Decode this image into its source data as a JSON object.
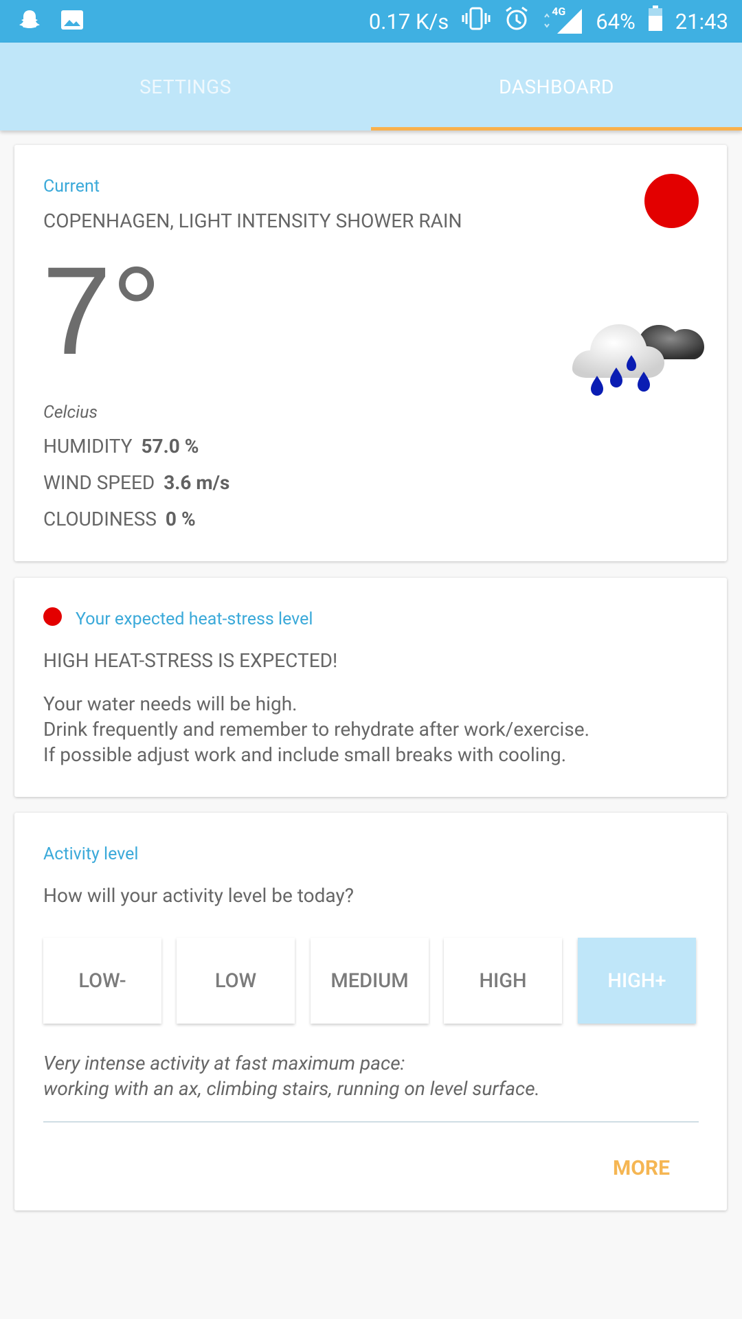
{
  "status_bar": {
    "network_speed": "0.17 K/s",
    "network_type": "4G",
    "battery": "64%",
    "time": "21:43"
  },
  "tabs": {
    "settings": "SETTINGS",
    "dashboard": "DASHBOARD",
    "active": "DASHBOARD"
  },
  "current": {
    "caption": "Current",
    "location": "COPENHAGEN, LIGHT INTENSITY SHOWER RAIN",
    "temperature": "7°",
    "unit": "Celcius",
    "humidity_label": "HUMIDITY",
    "humidity_value": "57.0 %",
    "wind_label": "WIND SPEED",
    "wind_value": "3.6 m/s",
    "cloud_label": "CLOUDINESS",
    "cloud_value": "0 %",
    "indicator_color": "#e30000"
  },
  "heat_stress": {
    "caption": "Your expected heat-stress level",
    "headline": "HIGH HEAT-STRESS IS EXPECTED!",
    "lines": [
      "Your water needs will be high.",
      "Drink frequently and remember to rehydrate after work/exercise.",
      "If possible adjust work and include small breaks with cooling."
    ]
  },
  "activity": {
    "caption": "Activity level",
    "question": "How will your activity level be today?",
    "options": [
      "LOW-",
      "LOW",
      "MEDIUM",
      "HIGH",
      "HIGH+"
    ],
    "selected": "HIGH+",
    "description": [
      "Very intense activity at fast maximum pace:",
      "working with an ax, climbing stairs, running on level surface."
    ],
    "more_label": "MORE"
  },
  "colors": {
    "status_bar": "#3fb0e2",
    "tab_bar": "#bfe6f9",
    "accent": "#f9b14d",
    "caption": "#3aa9d9",
    "alert": "#e30000"
  }
}
